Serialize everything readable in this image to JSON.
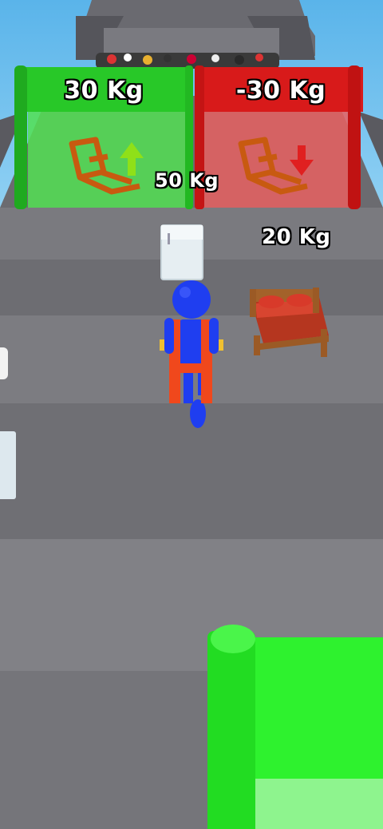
{
  "gates": {
    "left": {
      "label": "30 Kg",
      "direction": "up",
      "color": "#2fd22f"
    },
    "right": {
      "label": "-30 Kg",
      "direction": "down",
      "color": "#e01b1b"
    }
  },
  "pickups": {
    "box_weight": "50 Kg",
    "bed_weight": "20 Kg"
  },
  "colors": {
    "player": "#1f3ef0",
    "overalls": "#f0481c",
    "road": "#6b6b70",
    "finish_gate": "#2ef22e"
  }
}
